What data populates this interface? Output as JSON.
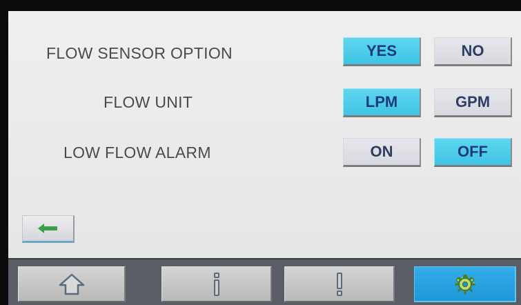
{
  "settings": {
    "rows": [
      {
        "label": "FLOW SENSOR OPTION",
        "options": [
          "YES",
          "NO"
        ],
        "selected": "YES"
      },
      {
        "label": "FLOW UNIT",
        "options": [
          "LPM",
          "GPM"
        ],
        "selected": "LPM"
      },
      {
        "label": "LOW FLOW ALARM",
        "options": [
          "ON",
          "OFF"
        ],
        "selected": "OFF"
      }
    ]
  },
  "back_button": {
    "icon": "arrow-left-icon"
  },
  "nav": {
    "items": [
      {
        "icon": "home-icon",
        "active": false
      },
      {
        "icon": "info-icon",
        "active": false
      },
      {
        "icon": "alert-icon",
        "active": false
      },
      {
        "icon": "gear-icon",
        "active": true
      }
    ]
  },
  "colors": {
    "active_button": "#3ec4e4",
    "inactive_button": "#dcdce2",
    "button_text": "#1b3a78",
    "label_text": "#4a4a4a",
    "nav_bar": "#5a5d66",
    "nav_active": "#1f97d6",
    "back_arrow": "#3aa04a"
  }
}
